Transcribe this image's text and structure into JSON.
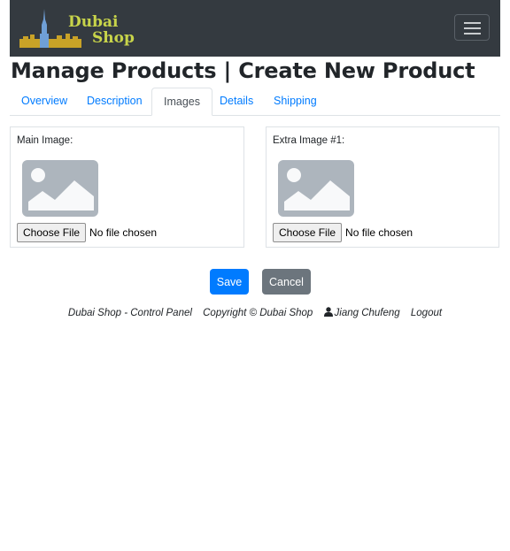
{
  "navbar": {
    "logo_line1": "Dubai",
    "logo_line2": "Shop",
    "toggler_icon": "hamburger-menu-icon"
  },
  "page_title": "Manage Products | Create New Product",
  "tabs": [
    {
      "label": "Overview",
      "active": false
    },
    {
      "label": "Description",
      "active": false
    },
    {
      "label": "Images",
      "active": true
    },
    {
      "label": "Details",
      "active": false
    },
    {
      "label": "Shipping",
      "active": false
    }
  ],
  "images": [
    {
      "label": "Main Image:",
      "button": "Choose File",
      "status": "No file chosen"
    },
    {
      "label": "Extra Image #1:",
      "button": "Choose File",
      "status": "No file chosen"
    }
  ],
  "actions": {
    "save": "Save",
    "cancel": "Cancel"
  },
  "footer": {
    "brand": "Dubai Shop - Control Panel",
    "copyright": "Copyright © Dubai Shop",
    "user": "Jiang Chufeng",
    "logout": "Logout"
  },
  "colors": {
    "navbar_bg": "#343a40",
    "primary": "#007bff",
    "secondary": "#6c757d",
    "logo_text": "#c8d44a"
  }
}
